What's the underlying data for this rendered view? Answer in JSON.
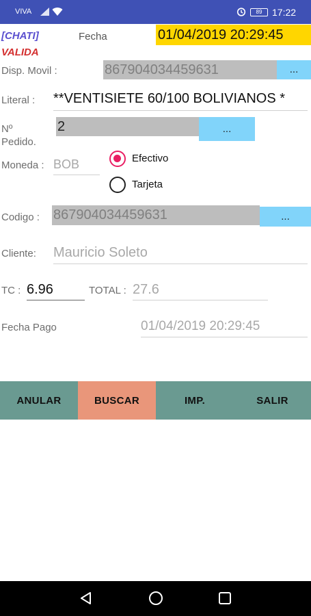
{
  "status_bar": {
    "carrier": "VIVA",
    "time": "17:22",
    "battery": "89"
  },
  "header": {
    "app_tag": "[CHATI]",
    "status": "VALIDA",
    "fecha_label": "Fecha",
    "fecha_value": "01/04/2019 20:29:45"
  },
  "form": {
    "disp_movil": {
      "label": "Disp. Movil :",
      "value": "867904034459631",
      "button": "..."
    },
    "literal": {
      "label": "Literal :",
      "value": "**VENTISIETE 60/100 BOLIVIANOS *"
    },
    "pedido": {
      "label_line1": "Nº",
      "label_line2": "Pedido.",
      "value": "2",
      "button": "..."
    },
    "moneda": {
      "label": "Moneda :",
      "value": "BOB"
    },
    "payment": {
      "options": [
        "Efectivo",
        "Tarjeta"
      ],
      "selected": "Efectivo"
    },
    "codigo": {
      "label": "Codigo :",
      "value": "867904034459631",
      "button": "..."
    },
    "cliente": {
      "label": "Cliente:",
      "value": "Mauricio Soleto"
    },
    "tc": {
      "label": "TC :",
      "value": "6.96"
    },
    "total": {
      "label": "TOTAL :",
      "value": "27.6"
    },
    "fecha_pago": {
      "label": "Fecha Pago",
      "value": "01/04/2019 20:29:45"
    }
  },
  "actions": {
    "anular": "ANULAR",
    "buscar": "BUSCAR",
    "imp": "IMP.",
    "salir": "SALIR"
  },
  "colors": {
    "status_bar": "#3f51b5",
    "date_highlight": "#ffd600",
    "field_gray": "#bdbdbd",
    "field_button": "#81d4fa",
    "action_teal": "#6a9a91",
    "action_selected": "#e9967a",
    "radio_accent": "#e91e63",
    "valida_red": "#d32f2f",
    "app_tag_blue": "#5a4fcf"
  }
}
